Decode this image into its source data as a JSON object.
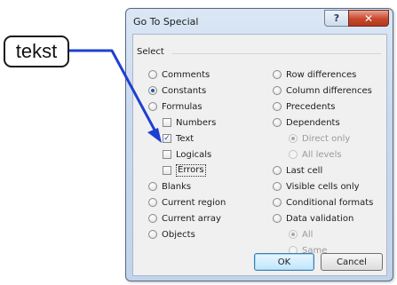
{
  "dialog": {
    "title": "Go To Special",
    "help_label": "?",
    "close_label": "✕",
    "group_label": "Select"
  },
  "left_options": [
    {
      "label": "Comments",
      "checked": false
    },
    {
      "label": "Constants",
      "checked": true
    },
    {
      "label": "Formulas",
      "checked": false
    }
  ],
  "formula_checks": [
    {
      "label": "Numbers",
      "checked": false
    },
    {
      "label": "Text",
      "checked": true
    },
    {
      "label": "Logicals",
      "checked": false
    },
    {
      "label": "Errors",
      "checked": false
    }
  ],
  "left_options_2": [
    {
      "label": "Blanks",
      "checked": false
    },
    {
      "label": "Current region",
      "checked": false
    },
    {
      "label": "Current array",
      "checked": false
    },
    {
      "label": "Objects",
      "checked": false
    }
  ],
  "right_options": [
    {
      "label": "Row differences"
    },
    {
      "label": "Column differences"
    },
    {
      "label": "Precedents"
    },
    {
      "label": "Dependents"
    }
  ],
  "dependents_sub": [
    {
      "label": "Direct only",
      "checked": true
    },
    {
      "label": "All levels",
      "checked": false
    }
  ],
  "right_options_2": [
    {
      "label": "Last cell"
    },
    {
      "label": "Visible cells only"
    },
    {
      "label": "Conditional formats"
    },
    {
      "label": "Data validation"
    }
  ],
  "validation_sub": [
    {
      "label": "All",
      "checked": true
    },
    {
      "label": "Same",
      "checked": false
    }
  ],
  "buttons": {
    "ok": "OK",
    "cancel": "Cancel"
  },
  "annotation": {
    "text": "tekst",
    "color": "#1f3fd1"
  }
}
